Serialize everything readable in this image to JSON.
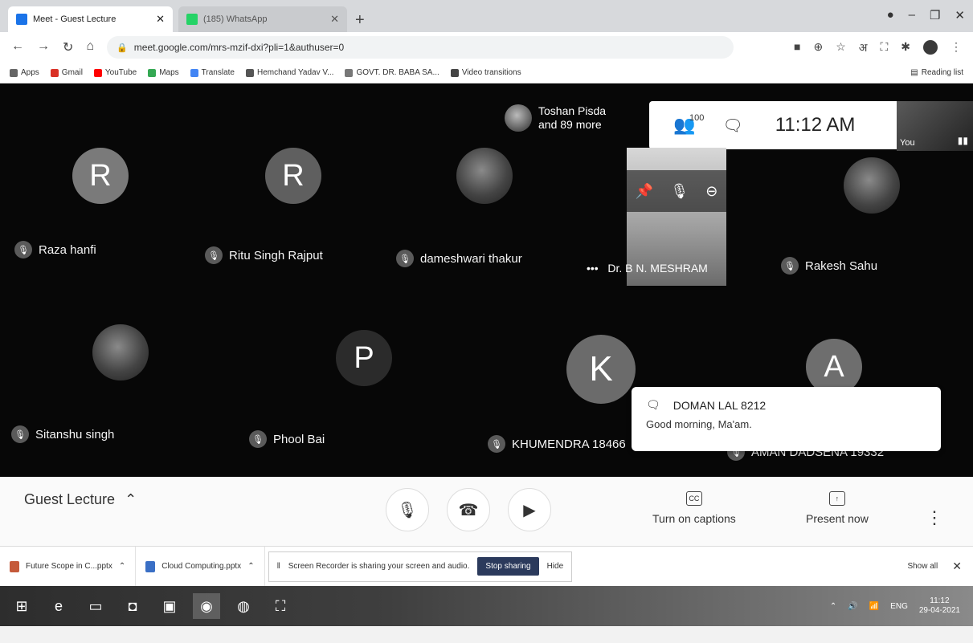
{
  "tabs": [
    {
      "title": "Meet - Guest Lecture",
      "active": true,
      "favicon_color": "#1a73e8"
    },
    {
      "title": "(185) WhatsApp",
      "active": false,
      "favicon_color": "#25d366"
    }
  ],
  "address_bar": {
    "url": "meet.google.com/mrs-mzif-dxi?pli=1&authuser=0"
  },
  "bookmarks": [
    {
      "label": "Apps",
      "color": "#666666"
    },
    {
      "label": "Gmail",
      "color": "#d93025"
    },
    {
      "label": "YouTube",
      "color": "#ff0000"
    },
    {
      "label": "Maps",
      "color": "#34a853"
    },
    {
      "label": "Translate",
      "color": "#4285f4"
    },
    {
      "label": "Hemchand Yadav V...",
      "color": "#555555"
    },
    {
      "label": "GOVT. DR. BABA SA...",
      "color": "#777777"
    },
    {
      "label": "Video transitions",
      "color": "#444444"
    }
  ],
  "reading_list": "Reading list",
  "meet": {
    "top_participant": {
      "name": "Toshan Pisda",
      "more": "and 89 more"
    },
    "participant_count": "100",
    "clock": "11:12 AM",
    "self_label": "You",
    "pinned_name": "Dr. B N. MESHRAM",
    "participants": [
      {
        "name": "Raza hanfi",
        "initial": "R",
        "avatar_color": "#7a7a7a"
      },
      {
        "name": "Ritu Singh Rajput",
        "initial": "R",
        "avatar_color": "#5f5f5f"
      },
      {
        "name": "dameshwari thakur",
        "initial": "",
        "avatar_color": "photo"
      },
      {
        "name": "Rakesh Sahu",
        "initial": "",
        "avatar_color": "photo"
      },
      {
        "name": "Sitanshu singh",
        "initial": "",
        "avatar_color": "photo"
      },
      {
        "name": "Phool Bai",
        "initial": "P",
        "avatar_color": "#2b2b2b"
      },
      {
        "name": "KHUMENDRA 18466",
        "initial": "K",
        "avatar_color": "#6b6b6b"
      },
      {
        "name": "AMAN DADSENA 19332",
        "initial": "A",
        "avatar_color": "#6e6e6e"
      }
    ],
    "toast": {
      "sender": "DOMAN LAL 8212",
      "message": "Good morning, Ma'am."
    },
    "meeting_name": "Guest Lecture",
    "captions_label": "Turn on captions",
    "present_label": "Present now"
  },
  "downloads": [
    {
      "name": "Future Scope in C...pptx"
    },
    {
      "name": "Cloud Computing.pptx"
    }
  ],
  "recorder": {
    "text": "Screen Recorder is sharing your screen and audio.",
    "stop_label": "Stop sharing",
    "hide_label": "Hide"
  },
  "show_all": "Show all",
  "tray": {
    "lang": "ENG",
    "time": "11:12",
    "date": "29-04-2021"
  }
}
